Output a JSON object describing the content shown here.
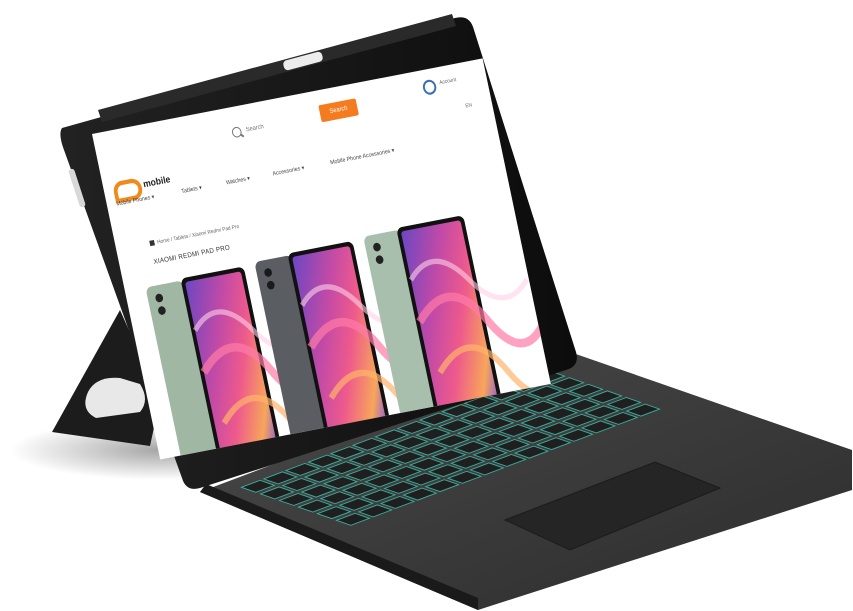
{
  "screen": {
    "search": {
      "placeholder": "Search",
      "button_label": "Search"
    },
    "account_label": "Account",
    "language_label": "EN",
    "logo": {
      "name": "mobile",
      "tagline": ""
    },
    "categories": [
      {
        "label": "Mobile Phones",
        "arrow": "▾"
      },
      {
        "label": "Tablets",
        "arrow": "▾"
      },
      {
        "label": "Watches",
        "arrow": "▾"
      },
      {
        "label": "Accessories",
        "arrow": "▾"
      },
      {
        "label": "Mobile Phone Accessories",
        "arrow": "▾"
      }
    ],
    "breadcrumb": "Home  /  Tablets  /  Xiaomi Redmi Pad Pro",
    "product_title": "XIAOMI REDMI PAD PRO"
  },
  "colors": {
    "tablet_frame": "#141414",
    "keyboard": "#3a3a3a",
    "key_backlight": "#3fd6c2",
    "accent": "#f47b20",
    "wallpaper_pink": "#e04a8a",
    "wallpaper_purple": "#7a4fc4",
    "wallpaper_orange": "#f49a4a",
    "device_green": "#9fb7a3",
    "device_grey": "#5a5d62"
  },
  "icons": [
    "search-icon",
    "account-icon",
    "home-icon",
    "camera-icon"
  ]
}
